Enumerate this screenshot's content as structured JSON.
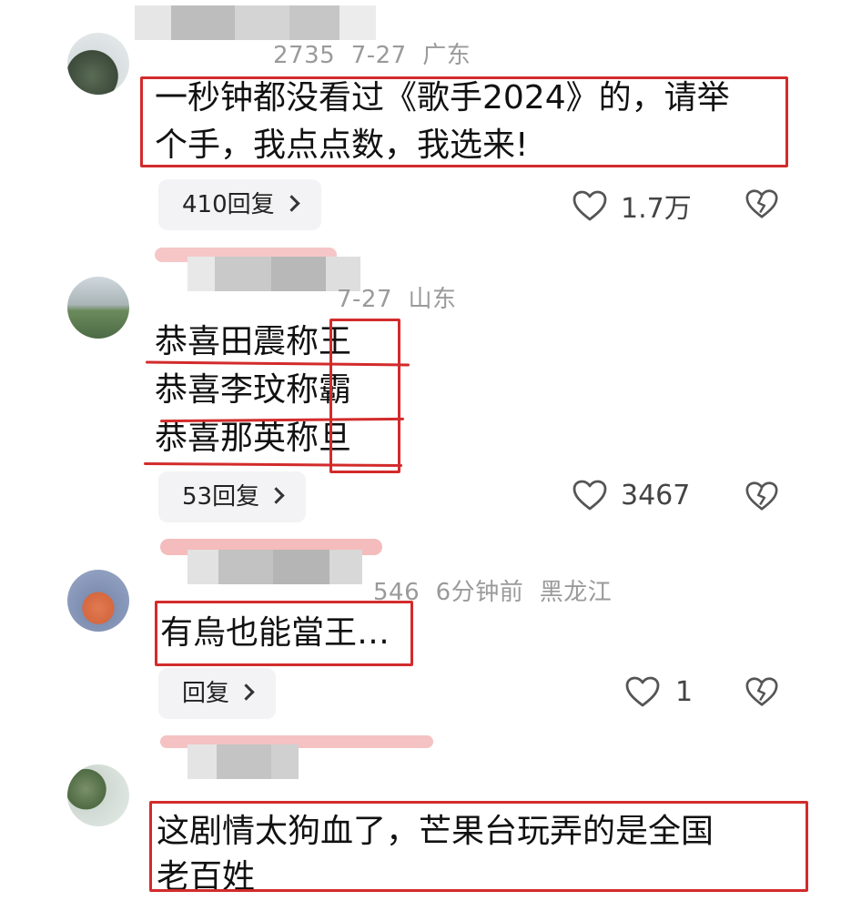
{
  "colors": {
    "highlight_red": "#d32b2b",
    "meta_gray": "#9a9a9a",
    "reply_bg": "#f3f3f5"
  },
  "comments": [
    {
      "meta": "2735  7-27  广东",
      "lines": [
        "一秒钟都没看过《歌手2024》的，请举",
        "个手，我点点数，我选来!"
      ],
      "reply_label": "410回复",
      "likes": "1.7万",
      "like_icon": "heart-icon",
      "dislike_icon": "broken-heart-icon"
    },
    {
      "meta": "7-27  山东",
      "lines": [
        "恭喜田震称王",
        "恭喜李玟称霸",
        "恭喜那英称旦"
      ],
      "reply_label": "53回复",
      "likes": "3467",
      "like_icon": "heart-icon",
      "dislike_icon": "broken-heart-icon"
    },
    {
      "meta": "546  6分钟前  黑龙江",
      "lines": [
        "有烏也能當王…"
      ],
      "reply_label": "回复",
      "likes": "1",
      "like_icon": "heart-icon",
      "dislike_icon": "broken-heart-icon"
    },
    {
      "meta": "",
      "lines": [
        "这剧情太狗血了，芒果台玩弄的是全国",
        "老百姓"
      ],
      "reply_label": "",
      "likes": "",
      "like_icon": "",
      "dislike_icon": ""
    }
  ]
}
